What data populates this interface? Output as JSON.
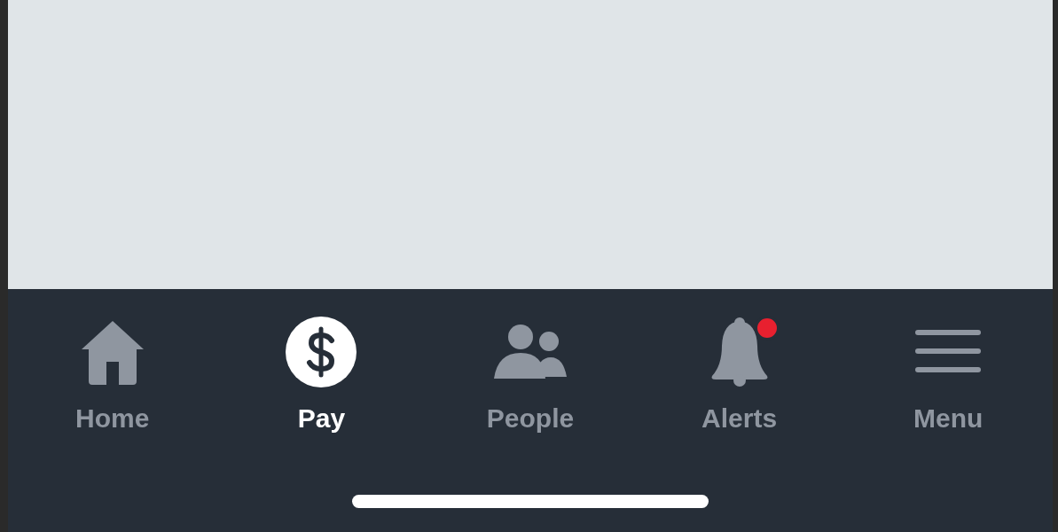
{
  "tab_bar": {
    "tabs": [
      {
        "kind": "home",
        "label": "Home",
        "selected": false,
        "badge": false
      },
      {
        "kind": "pay",
        "label": "Pay",
        "selected": true,
        "badge": false
      },
      {
        "kind": "people",
        "label": "People",
        "selected": false,
        "badge": false
      },
      {
        "kind": "alerts",
        "label": "Alerts",
        "selected": false,
        "badge": true
      },
      {
        "kind": "menu",
        "label": "Menu",
        "selected": false,
        "badge": false
      }
    ]
  }
}
